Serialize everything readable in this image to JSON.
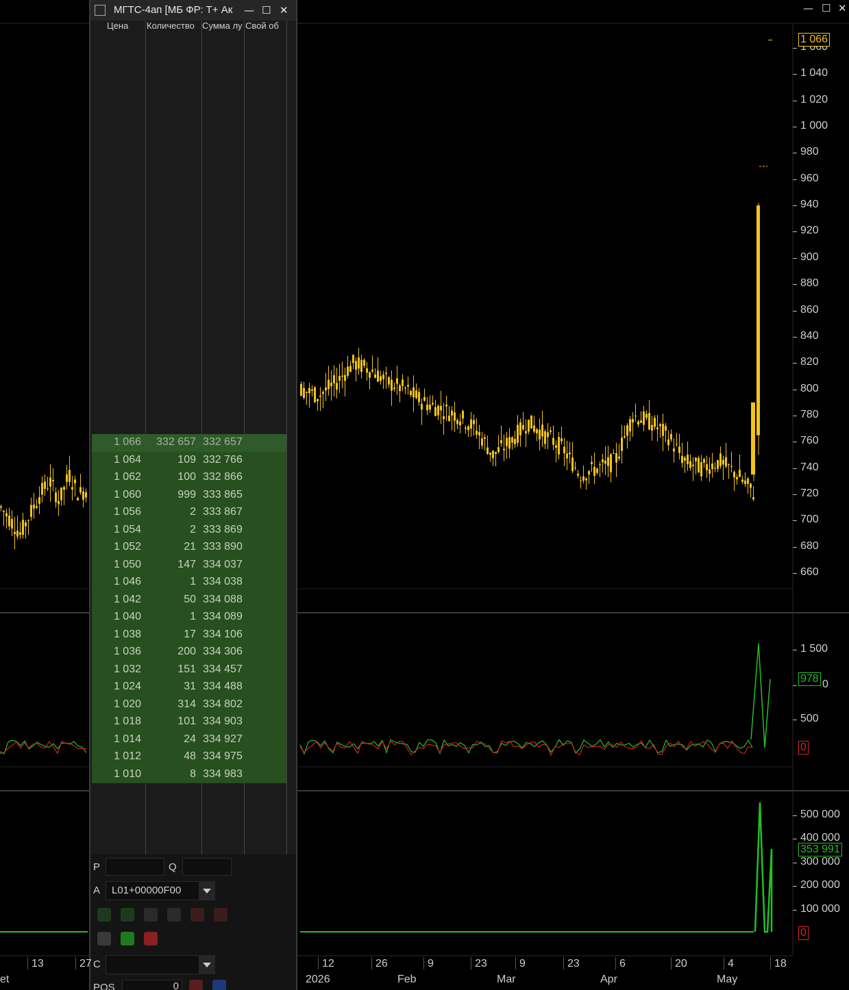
{
  "window_controls": {
    "minimize": "—",
    "maximize": "☐",
    "close": "✕"
  },
  "order_book": {
    "title": "МГТС-4ап [МБ ФР: Т+ Ак",
    "columns": [
      "Цена",
      "Количество",
      "Сумма лу",
      "Свой об"
    ],
    "rows": [
      {
        "price": "1 066",
        "qty": "332 657",
        "sum": "332 657"
      },
      {
        "price": "1 064",
        "qty": "109",
        "sum": "332 766"
      },
      {
        "price": "1 062",
        "qty": "100",
        "sum": "332 866"
      },
      {
        "price": "1 060",
        "qty": "999",
        "sum": "333 865"
      },
      {
        "price": "1 056",
        "qty": "2",
        "sum": "333 867"
      },
      {
        "price": "1 054",
        "qty": "2",
        "sum": "333 869"
      },
      {
        "price": "1 052",
        "qty": "21",
        "sum": "333 890"
      },
      {
        "price": "1 050",
        "qty": "147",
        "sum": "334 037"
      },
      {
        "price": "1 046",
        "qty": "1",
        "sum": "334 038"
      },
      {
        "price": "1 042",
        "qty": "50",
        "sum": "334 088"
      },
      {
        "price": "1 040",
        "qty": "1",
        "sum": "334 089"
      },
      {
        "price": "1 038",
        "qty": "17",
        "sum": "334 106"
      },
      {
        "price": "1 036",
        "qty": "200",
        "sum": "334 306"
      },
      {
        "price": "1 032",
        "qty": "151",
        "sum": "334 457"
      },
      {
        "price": "1 024",
        "qty": "31",
        "sum": "334 488"
      },
      {
        "price": "1 020",
        "qty": "314",
        "sum": "334 802"
      },
      {
        "price": "1 018",
        "qty": "101",
        "sum": "334 903"
      },
      {
        "price": "1 014",
        "qty": "24",
        "sum": "334 927"
      },
      {
        "price": "1 012",
        "qty": "48",
        "sum": "334 975"
      },
      {
        "price": "1 010",
        "qty": "8",
        "sum": "334 983"
      }
    ],
    "form": {
      "p_label": "P",
      "q_label": "Q",
      "a_label": "A",
      "c_label": "C",
      "account": "L01+00000F00",
      "pos_label": "POS",
      "pos_value": "0"
    }
  },
  "price_axis": {
    "ticks": [
      "1 060",
      "1 040",
      "1 020",
      "1 000",
      "980",
      "960",
      "940",
      "920",
      "900",
      "880",
      "860",
      "840",
      "820",
      "800",
      "780",
      "760",
      "740",
      "720",
      "700",
      "680",
      "660"
    ],
    "tick_values": [
      1060,
      1040,
      1020,
      1000,
      980,
      960,
      940,
      920,
      900,
      880,
      860,
      840,
      820,
      800,
      780,
      760,
      740,
      720,
      700,
      680,
      660
    ],
    "last_price": "1 066",
    "last_price_value": 1066
  },
  "osc_axis": {
    "ticks": [
      "1 500",
      "0",
      "500"
    ],
    "current": "978",
    "zero": "0"
  },
  "volume_axis": {
    "ticks": [
      "500 000",
      "400 000",
      "300 000",
      "200 000",
      "100 000"
    ],
    "current": "353 991",
    "zero": "0"
  },
  "time_axis": {
    "day_ticks": [
      "13",
      "27",
      "12",
      "26",
      "9",
      "23",
      "9",
      "23",
      "6",
      "20",
      "4",
      "18"
    ],
    "month_labels": [
      "et",
      "2026",
      "Feb",
      "Mar",
      "Apr",
      "May"
    ]
  },
  "colors": {
    "candle": "#f2c418",
    "bg": "#000000",
    "ob_green": "#274f20",
    "osc_green": "#22c022",
    "osc_red": "#d02020",
    "label_green": "#22c022",
    "label_red": "#e02020"
  }
}
